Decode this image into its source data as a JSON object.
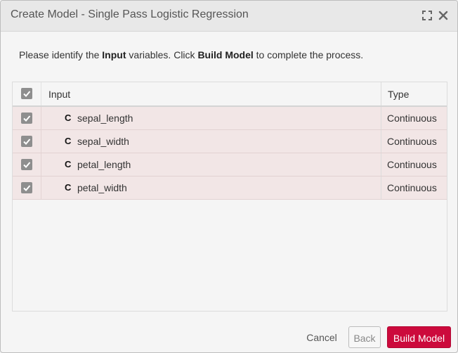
{
  "dialog": {
    "title": "Create Model - Single Pass Logistic Regression",
    "expand_icon": "expand-icon",
    "close_icon": "close-icon"
  },
  "instructions": {
    "part1": "Please identify the ",
    "bold1": "Input",
    "part2": " variables. Click ",
    "bold2": "Build Model",
    "part3": " to complete the process."
  },
  "grid": {
    "columns": {
      "input": "Input",
      "type": "Type"
    },
    "header_checked": true,
    "rows": [
      {
        "badge": "C",
        "name": "sepal_length",
        "type": "Continuous",
        "checked": true
      },
      {
        "badge": "C",
        "name": "sepal_width",
        "type": "Continuous",
        "checked": true
      },
      {
        "badge": "C",
        "name": "petal_length",
        "type": "Continuous",
        "checked": true
      },
      {
        "badge": "C",
        "name": "petal_width",
        "type": "Continuous",
        "checked": true
      }
    ]
  },
  "footer": {
    "cancel_label": "Cancel",
    "back_label": "Back",
    "build_label": "Build Model"
  },
  "colors": {
    "accent": "#cc0a3c",
    "row_selected": "#f2e6e6",
    "checkbox": "#8e8e8e"
  }
}
